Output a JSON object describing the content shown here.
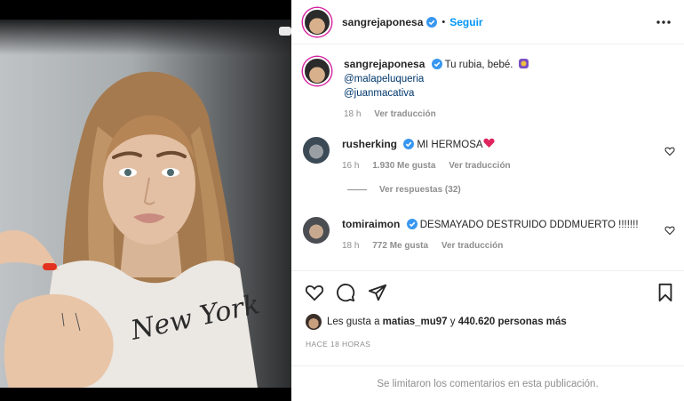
{
  "post": {
    "author": "sangrejaponesa",
    "follow_label": "Seguir",
    "dot": "•"
  },
  "caption": {
    "username": "sangrejaponesa",
    "text": "Tu rubia, bebé.",
    "mentions": [
      "@malapeluqueria",
      "@juanmacativa"
    ],
    "time": "18 h",
    "translate": "Ver traducción"
  },
  "comments": [
    {
      "username": "rusherking",
      "text": "MI HERMOSA",
      "time": "16 h",
      "likes": "1.930 Me gusta",
      "translate": "Ver traducción",
      "replies": "Ver respuestas (32)"
    },
    {
      "username": "tomiraimon",
      "text": "DESMAYADO DESTRUIDO DDDMUERTO !!!!!!!",
      "time": "18 h",
      "likes": "772 Me gusta",
      "translate": "Ver traducción"
    }
  ],
  "likes_line": {
    "prefix": "Les gusta a",
    "user": "matias_mu97",
    "middle": "y",
    "count": "440.620 personas más"
  },
  "timestamp": "HACE 18 HORAS",
  "footer": "Se limitaron los comentarios en esta publicación.",
  "colors": {
    "accent": "#0095f6",
    "verified": "#3897f0",
    "heart": "#e0245e"
  },
  "icons": [
    "verified-icon",
    "more-icon",
    "heart-icon",
    "comment-icon",
    "share-icon",
    "bookmark-icon"
  ]
}
